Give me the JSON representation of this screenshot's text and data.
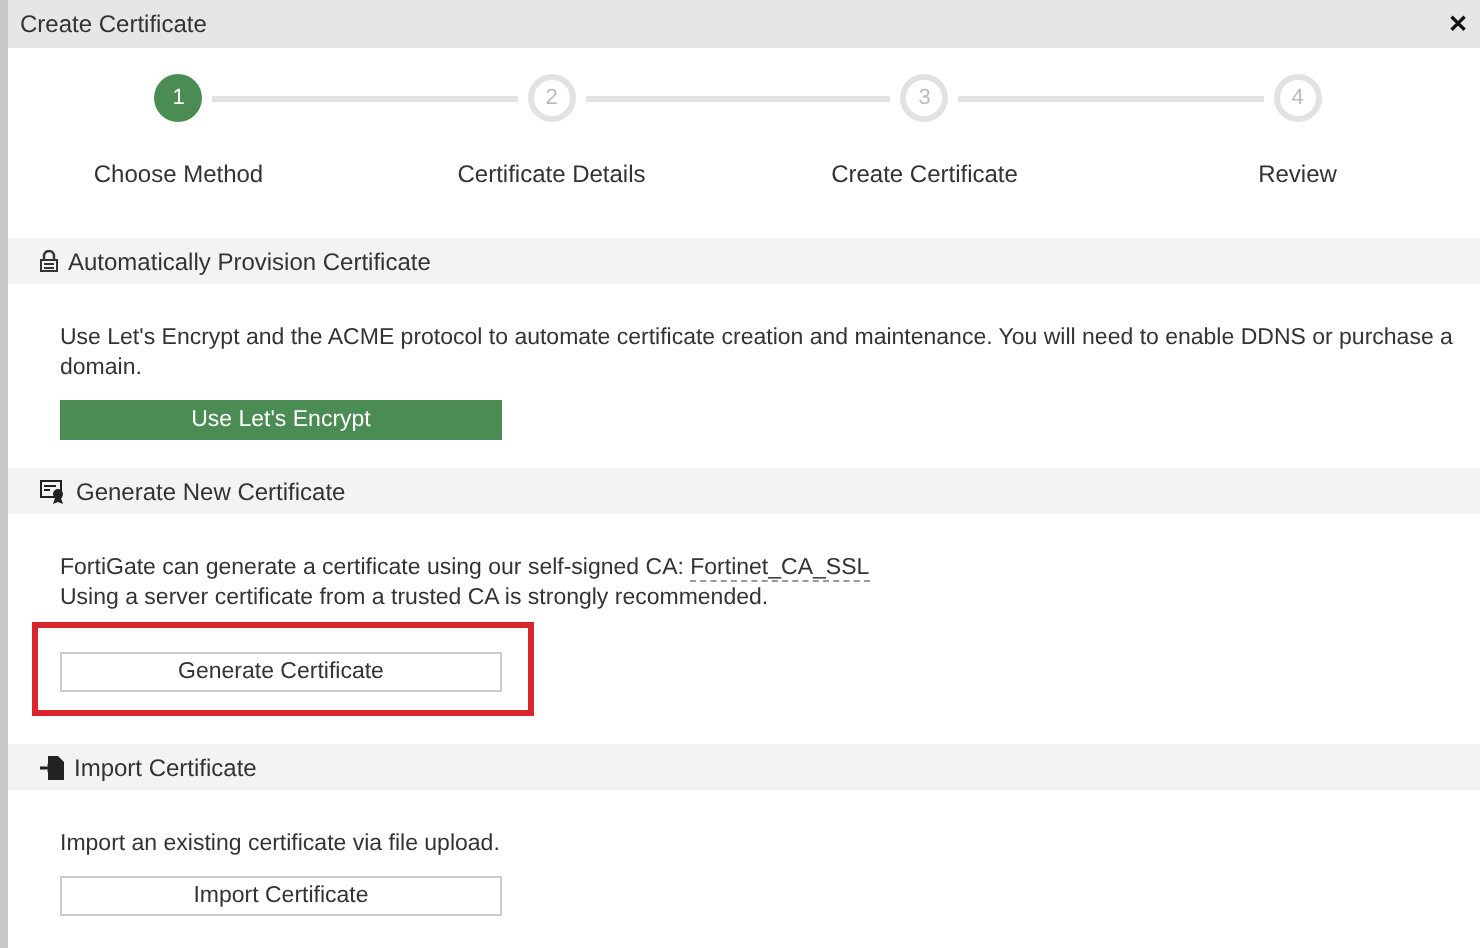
{
  "window": {
    "title": "Create Certificate",
    "close": "✕"
  },
  "steps": [
    {
      "number": "1",
      "label": "Choose Method",
      "selected": true
    },
    {
      "number": "2",
      "label": "Certificate Details",
      "selected": false
    },
    {
      "number": "3",
      "label": "Create Certificate",
      "selected": false
    },
    {
      "number": "4",
      "label": "Review",
      "selected": false
    }
  ],
  "sections": [
    {
      "kind": "auto",
      "title": "Automatically Provision Certificate",
      "lines": [
        {
          "text": "Use Let's Encrypt and the ACME protocol to automate certificate creation and maintenance. You will need to enable DDNS or purchase a domain."
        }
      ],
      "button": {
        "label": "Use Let's Encrypt",
        "primary": true
      },
      "highlighted": false
    },
    {
      "kind": "generate",
      "title": "Generate New Certificate",
      "lines": [
        {
          "text": "FortiGate can generate a certificate using our self-signed CA: ",
          "link": "Fortinet_CA_SSL"
        },
        {
          "text": "Using a server certificate from a trusted CA is strongly recommended."
        }
      ],
      "button": {
        "label": "Generate Certificate",
        "primary": false
      },
      "highlighted": true
    },
    {
      "kind": "import",
      "title": "Import Certificate",
      "lines": [
        {
          "text": "Import an existing certificate via file upload."
        }
      ],
      "button": {
        "label": "Import Certificate",
        "primary": false
      },
      "highlighted": false
    }
  ]
}
